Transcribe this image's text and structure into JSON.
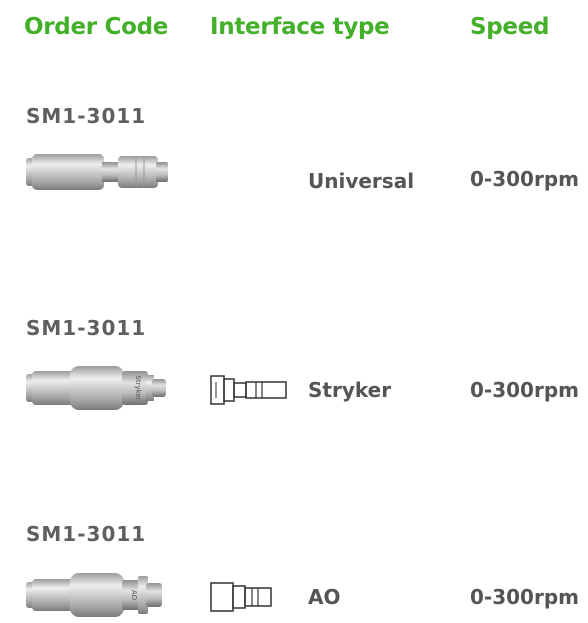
{
  "headers": {
    "order_code": "Order Code",
    "interface_type": "Interface type",
    "speed": "Speed"
  },
  "rows": [
    {
      "order_code": "SM1-3011",
      "interface": "Universal",
      "speed": "0-300rpm",
      "product_icon": "universal-attachment-icon"
    },
    {
      "order_code": "SM1-3011",
      "interface": "Stryker",
      "speed": "0-300rpm",
      "product_icon": "stryker-attachment-icon",
      "product_engraving": "Stryker",
      "connector_icon": "stryker-connector-icon"
    },
    {
      "order_code": "SM1-3011",
      "interface": "AO",
      "speed": "0-300rpm",
      "product_icon": "ao-attachment-icon",
      "product_engraving": "AO",
      "connector_icon": "ao-connector-icon"
    }
  ],
  "colors": {
    "header": "#43b02a",
    "code": "#5f5f5f",
    "text": "#555555"
  }
}
